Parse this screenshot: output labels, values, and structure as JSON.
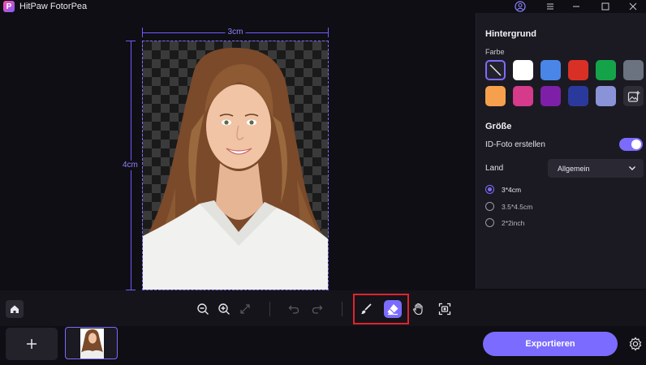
{
  "app": {
    "title": "HitPaw FotorPea",
    "logo_letter": "P"
  },
  "titlebar": {
    "icons": [
      "account-icon",
      "menu-icon",
      "minimize-icon",
      "maximize-icon",
      "close-icon"
    ]
  },
  "canvas": {
    "width_label": "3cm",
    "height_label": "4cm"
  },
  "panel": {
    "background_title": "Hintergrund",
    "color_label": "Farbe",
    "colors": [
      "none",
      "#ffffff",
      "#4a86e8",
      "#d93025",
      "#15a34a",
      "#6b7280",
      "#f6a04d",
      "#d63a8a",
      "#7e1fa8",
      "#2a3a9c",
      "#8a93d8",
      "upload"
    ],
    "size_title": "Größe",
    "id_photo_label": "ID-Foto erstellen",
    "id_photo_enabled": true,
    "country_label": "Land",
    "country_value": "Allgemein",
    "size_options": [
      {
        "label": "3*4cm",
        "selected": true
      },
      {
        "label": "3.5*4.5cm",
        "selected": false
      },
      {
        "label": "2*2inch",
        "selected": false
      }
    ]
  },
  "toolbar": {
    "tools": [
      "zoom-out-icon",
      "zoom-in-icon",
      "fit-icon",
      "undo-icon",
      "redo-icon",
      "brush-icon",
      "eraser-icon",
      "hand-icon",
      "crop-icon"
    ],
    "active_tool": "eraser-icon"
  },
  "bottom": {
    "add_label": "+",
    "export_label": "Exportieren"
  }
}
